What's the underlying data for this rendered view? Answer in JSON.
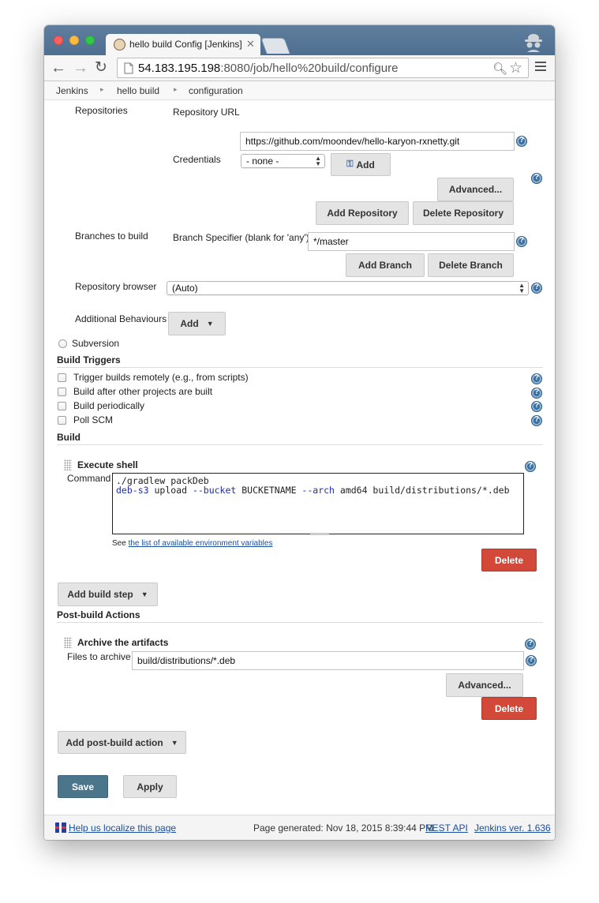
{
  "browser": {
    "tab_title": "hello build Config [Jenkins]",
    "url_host": "54.183.195.198",
    "url_rest": ":8080/job/hello%20build/configure"
  },
  "breadcrumb": [
    "Jenkins",
    "hello build",
    "configuration"
  ],
  "scm": {
    "repositories_label": "Repositories",
    "repository_url_label": "Repository URL",
    "repository_url_value": "https://github.com/moondev/hello-karyon-rxnetty.git",
    "credentials_label": "Credentials",
    "credentials_value": "- none -",
    "add_label": "Add",
    "advanced_label": "Advanced...",
    "add_repository_label": "Add Repository",
    "delete_repository_label": "Delete Repository",
    "branches_label": "Branches to build",
    "branch_specifier_label": "Branch Specifier (blank for 'any')",
    "branch_specifier_value": "*/master",
    "add_branch_label": "Add Branch",
    "delete_branch_label": "Delete Branch",
    "repo_browser_label": "Repository browser",
    "repo_browser_value": "(Auto)",
    "additional_behaviours_label": "Additional Behaviours",
    "additional_add_label": "Add",
    "subversion_label": "Subversion"
  },
  "build_triggers": {
    "title": "Build Triggers",
    "options": [
      "Trigger builds remotely (e.g., from scripts)",
      "Build after other projects are built",
      "Build periodically",
      "Poll SCM"
    ]
  },
  "build": {
    "title": "Build",
    "step_title": "Execute shell",
    "command_label": "Command",
    "command_lines": [
      "./gradlew packDeb",
      "deb-s3 upload --bucket BUCKETNAME --arch amd64 build/distributions/*.deb"
    ],
    "see_prefix": "See",
    "env_link": "the list of available environment variables",
    "delete_label": "Delete",
    "add_build_step_label": "Add build step"
  },
  "post_build": {
    "title": "Post-build Actions",
    "step_title": "Archive the artifacts",
    "files_label": "Files to archive",
    "files_value": "build/distributions/*.deb",
    "advanced_label": "Advanced...",
    "delete_label": "Delete",
    "add_action_label": "Add post-build action"
  },
  "actions": {
    "save_label": "Save",
    "apply_label": "Apply"
  },
  "footer": {
    "localize_link": "Help us localize this page",
    "page_generated": "Page generated: Nov 18, 2015 8:39:44 PM",
    "rest_api": "REST API",
    "version": "Jenkins ver. 1.636"
  },
  "colors": {
    "delete_button": "#d24939",
    "save_button": "#4b758b",
    "help_icon": "#3a6f9e"
  }
}
